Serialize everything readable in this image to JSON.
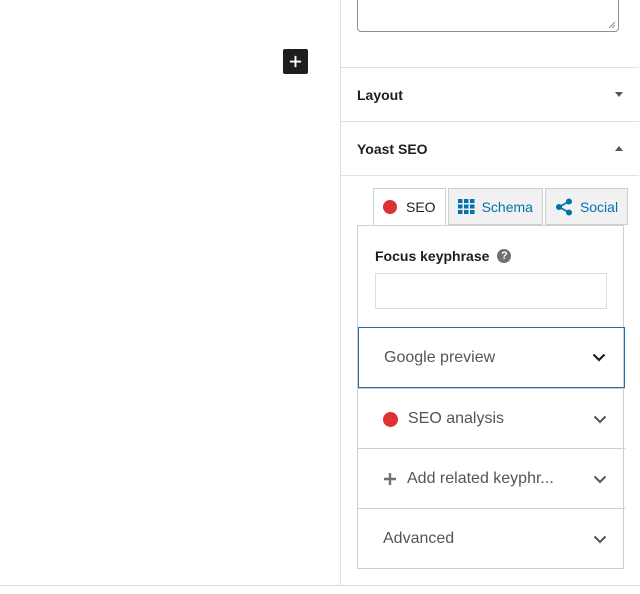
{
  "editor": {
    "add_block_label": "Add block"
  },
  "sidebar": {
    "panels": [
      {
        "title": "Layout"
      },
      {
        "title": "Yoast SEO"
      }
    ]
  },
  "yoast": {
    "tabs": [
      {
        "label": "SEO"
      },
      {
        "label": "Schema"
      },
      {
        "label": "Social"
      }
    ],
    "focus_keyphrase_label": "Focus keyphrase",
    "focus_keyphrase_value": "",
    "sections": [
      {
        "label": "Google preview"
      },
      {
        "label": "SEO analysis"
      },
      {
        "label": "Add related keyphr..."
      },
      {
        "label": "Advanced"
      }
    ]
  },
  "colors": {
    "accent": "#0073aa",
    "problem": "#dc3232",
    "focus": "#1e6fb2"
  }
}
